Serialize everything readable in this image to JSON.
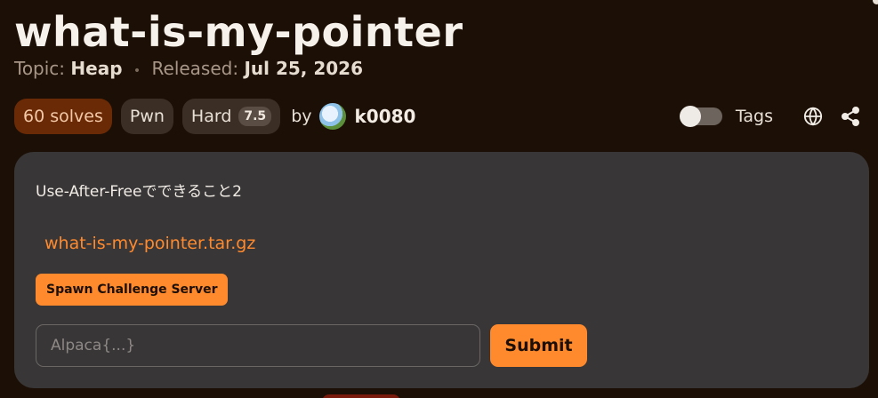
{
  "challenge": {
    "title": "what-is-my-pointer",
    "topic_label": "Topic:",
    "topic": "Heap",
    "released_label": "Released:",
    "released_date": "Jul 25, 2026",
    "dot_separator": "•"
  },
  "badges": {
    "solves": "60 solves",
    "category": "Pwn",
    "difficulty": "Hard",
    "difficulty_score": "7.5",
    "by_label": "by",
    "author": "k0080"
  },
  "tools": {
    "tags_label": "Tags",
    "tags_toggle_on": false,
    "globe_icon": "globe-icon",
    "share_icon": "share-icon"
  },
  "card": {
    "description": "Use-After-Freeでできること2",
    "file_name": "what-is-my-pointer.tar.gz",
    "spawn_label": "Spawn Challenge Server",
    "flag_placeholder": "Alpaca{...}",
    "flag_value": "",
    "submit_label": "Submit"
  },
  "colors": {
    "background": "#1c0f06",
    "accent": "#ff8a2e",
    "card": "#383637",
    "solves_pill": "#6b2a06"
  }
}
